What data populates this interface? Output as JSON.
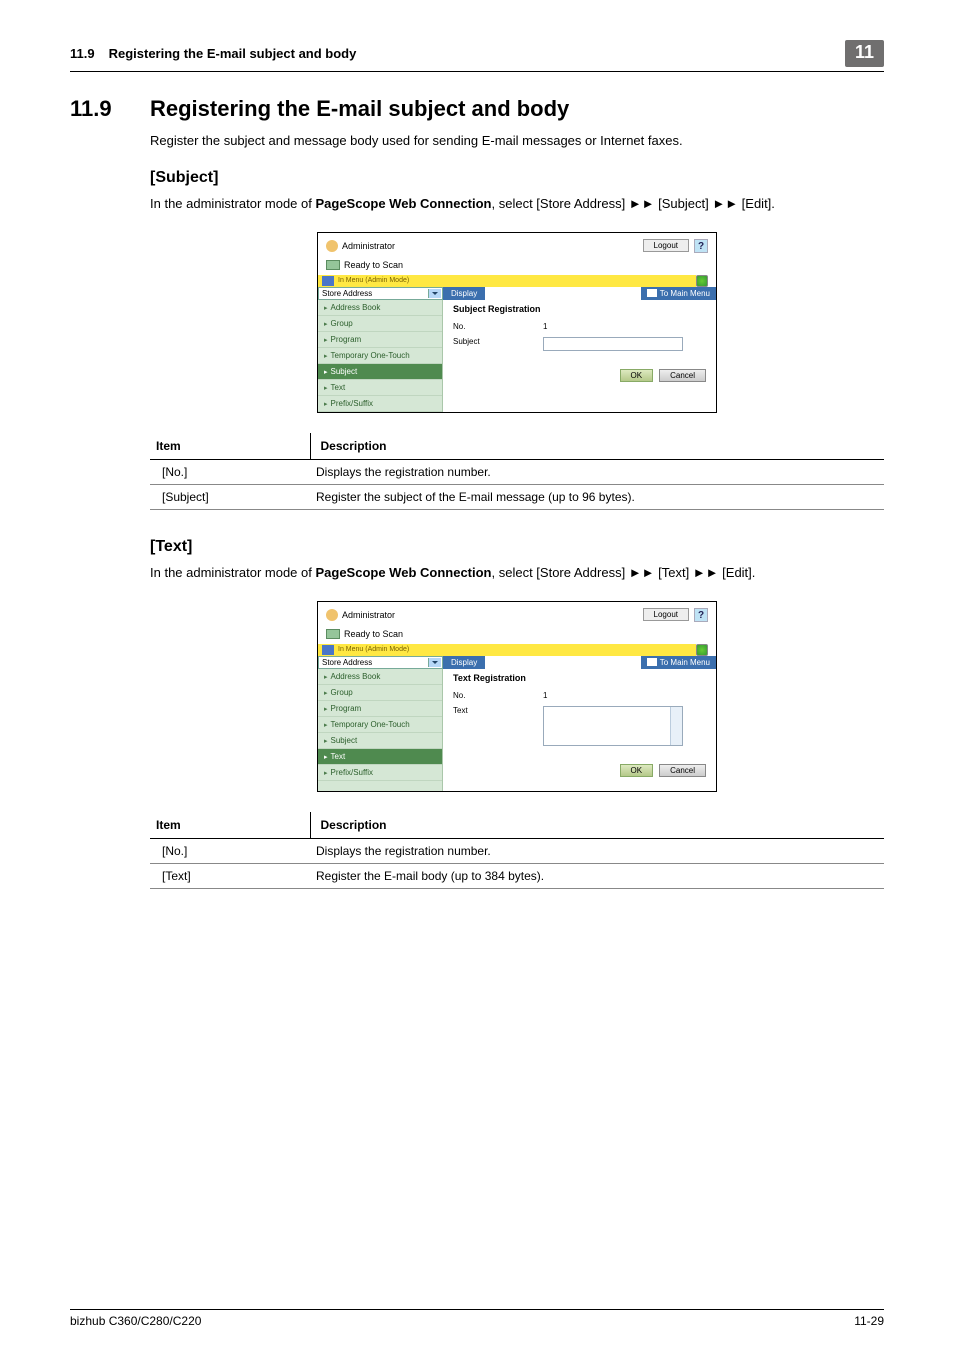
{
  "header": {
    "num": "11.9",
    "title": "Registering the E-mail subject and body",
    "badge": "11"
  },
  "section": {
    "num": "11.9",
    "title": "Registering the E-mail subject and body"
  },
  "intro": "Register the subject and message body used for sending E-mail messages or Internet faxes.",
  "subject": {
    "heading": "[Subject]",
    "text_pre": "In the administrator mode of ",
    "text_bold": "PageScope Web Connection",
    "text_post": ", select [Store Address] ►► [Subject] ►► [Edit].",
    "ui": {
      "admin": "Administrator",
      "logout": "Logout",
      "help": "?",
      "ready": "Ready to Scan",
      "mode": "In Menu (Admin Mode)",
      "dropdown": "Store Address",
      "display": "Display",
      "to_main": "To Main Menu",
      "side": [
        "Address Book",
        "Group",
        "Program",
        "Temporary One-Touch",
        "Subject",
        "Text",
        "Prefix/Suffix"
      ],
      "active_idx": 4,
      "form_title": "Subject Registration",
      "rows": {
        "no_label": "No.",
        "no_val": "1",
        "field_label": "Subject"
      },
      "ok": "OK",
      "cancel": "Cancel"
    },
    "table": {
      "h1": "Item",
      "h2": "Description",
      "rows": [
        [
          "[No.]",
          "Displays the registration number."
        ],
        [
          "[Subject]",
          "Register the subject of the E-mail message (up to 96 bytes)."
        ]
      ]
    }
  },
  "text_sec": {
    "heading": "[Text]",
    "text_pre": "In the administrator mode of ",
    "text_bold": "PageScope Web Connection",
    "text_post": ", select [Store Address] ►► [Text] ►► [Edit].",
    "ui": {
      "admin": "Administrator",
      "logout": "Logout",
      "help": "?",
      "ready": "Ready to Scan",
      "mode": "In Menu (Admin Mode)",
      "dropdown": "Store Address",
      "display": "Display",
      "to_main": "To Main Menu",
      "side": [
        "Address Book",
        "Group",
        "Program",
        "Temporary One-Touch",
        "Subject",
        "Text",
        "Prefix/Suffix"
      ],
      "active_idx": 5,
      "form_title": "Text Registration",
      "rows": {
        "no_label": "No.",
        "no_val": "1",
        "field_label": "Text"
      },
      "ok": "OK",
      "cancel": "Cancel"
    },
    "table": {
      "h1": "Item",
      "h2": "Description",
      "rows": [
        [
          "[No.]",
          "Displays the registration number."
        ],
        [
          "[Text]",
          "Register the E-mail body (up to 384 bytes)."
        ]
      ]
    }
  },
  "footer": {
    "left": "bizhub C360/C280/C220",
    "right": "11-29"
  }
}
